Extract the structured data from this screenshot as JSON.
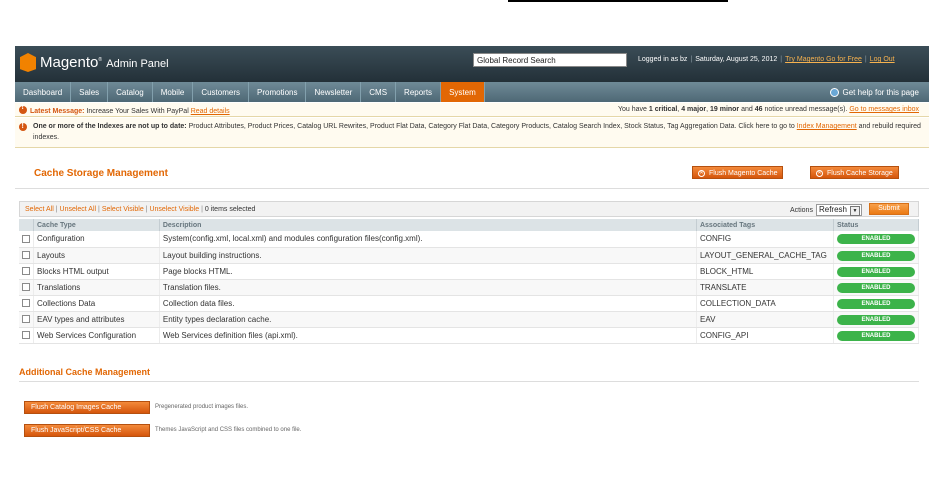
{
  "header": {
    "logo_main": "Magento",
    "logo_sub": "Admin Panel",
    "search_value": "Global Record Search",
    "logged_in": "Logged in as bz",
    "date": "Saturday, August 25, 2012",
    "try_link": "Try Magento Go for Free",
    "logout": "Log Out"
  },
  "nav": {
    "items": [
      "Dashboard",
      "Sales",
      "Catalog",
      "Mobile",
      "Customers",
      "Promotions",
      "Newsletter",
      "CMS",
      "Reports",
      "System"
    ],
    "active": "System",
    "help": "Get help for this page"
  },
  "messages": {
    "latest_label": "Latest Message:",
    "latest_text": "Increase Your Sales With PayPal",
    "read_details": "Read details",
    "unread_prefix": "You have",
    "critical": "1 critical",
    "major": "4 major",
    "minor": "19 minor",
    "notice_count": "46",
    "unread_suffix": "notice unread message(s).",
    "goto_inbox": "Go to messages inbox",
    "index_warning_bold": "One or more of the Indexes are not up to date:",
    "index_warning_text": "Product Attributes, Product Prices, Catalog URL Rewrites, Product Flat Data, Category Flat Data, Category Products, Catalog Search Index, Stock Status, Tag Aggregation Data. Click here to go to",
    "index_link": "Index Management",
    "index_suffix": "and rebuild required indexes."
  },
  "page": {
    "title": "Cache Storage Management",
    "flush_magento": "Flush Magento Cache",
    "flush_storage": "Flush Cache Storage"
  },
  "grid": {
    "select_all": "Select All",
    "unselect_all": "Unselect All",
    "select_visible": "Select Visible",
    "unselect_visible": "Unselect Visible",
    "items_selected": "0 items selected",
    "actions_label": "Actions",
    "actions_value": "Refresh",
    "submit": "Submit",
    "columns": [
      "Cache Type",
      "Description",
      "Associated Tags",
      "Status"
    ],
    "rows": [
      {
        "type": "Configuration",
        "desc": "System(config.xml, local.xml) and modules configuration files(config.xml).",
        "tags": "CONFIG",
        "status": "ENABLED"
      },
      {
        "type": "Layouts",
        "desc": "Layout building instructions.",
        "tags": "LAYOUT_GENERAL_CACHE_TAG",
        "status": "ENABLED"
      },
      {
        "type": "Blocks HTML output",
        "desc": "Page blocks HTML.",
        "tags": "BLOCK_HTML",
        "status": "ENABLED"
      },
      {
        "type": "Translations",
        "desc": "Translation files.",
        "tags": "TRANSLATE",
        "status": "ENABLED"
      },
      {
        "type": "Collections Data",
        "desc": "Collection data files.",
        "tags": "COLLECTION_DATA",
        "status": "ENABLED"
      },
      {
        "type": "EAV types and attributes",
        "desc": "Entity types declaration cache.",
        "tags": "EAV",
        "status": "ENABLED"
      },
      {
        "type": "Web Services Configuration",
        "desc": "Web Services definition files (api.xml).",
        "tags": "CONFIG_API",
        "status": "ENABLED"
      }
    ]
  },
  "additional": {
    "title": "Additional Cache Management",
    "catalog_button": "Flush Catalog Images Cache",
    "catalog_note": "Pregenerated product images files.",
    "js_button": "Flush JavaScript/CSS Cache",
    "js_note": "Themes JavaScript and CSS files combined to one file."
  },
  "colors": {
    "accent": "#e26704",
    "header_bg": "#2d3d46",
    "enabled": "#3cb34a"
  }
}
